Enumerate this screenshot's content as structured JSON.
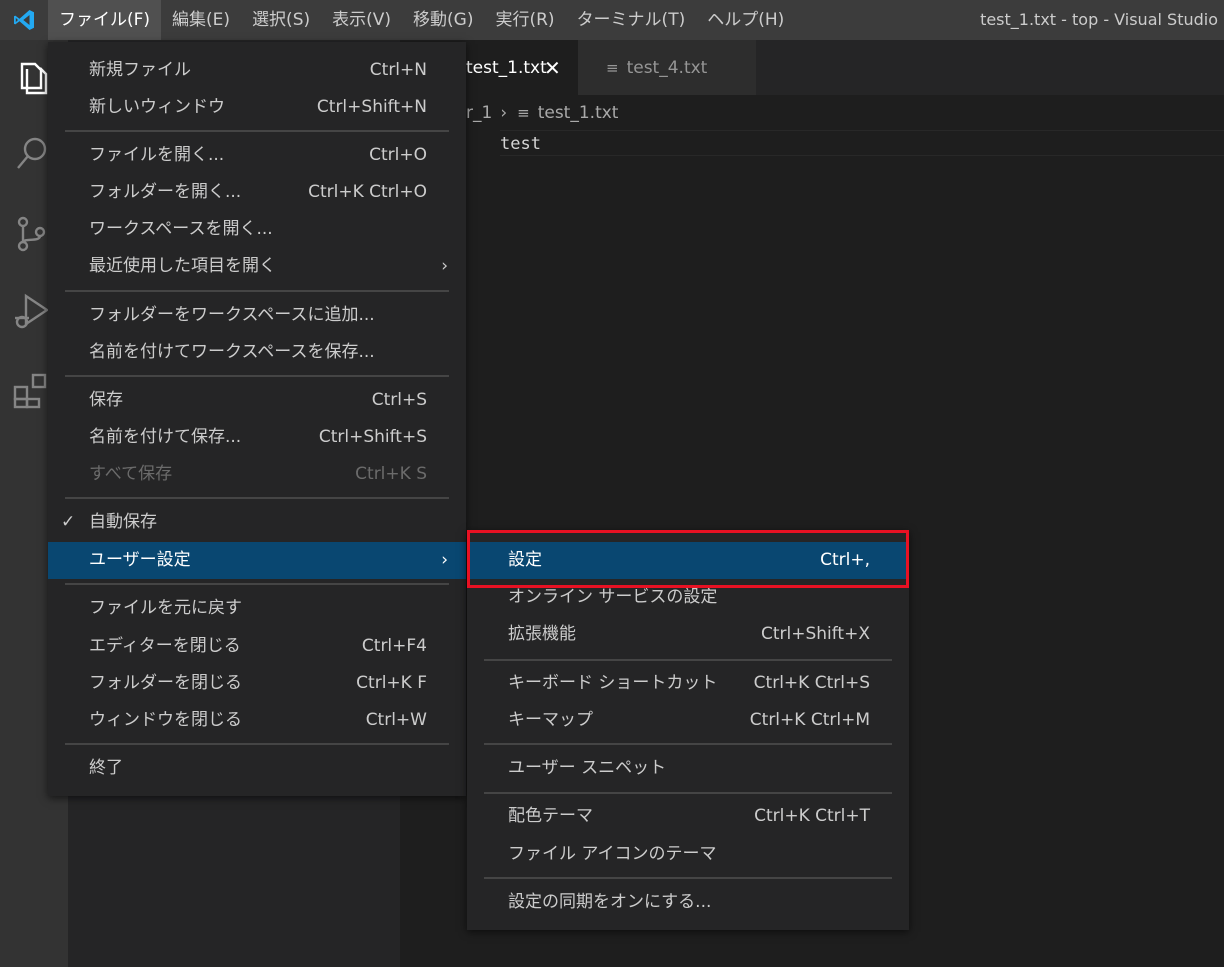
{
  "titlebar": {
    "menus": [
      "ファイル(F)",
      "編集(E)",
      "選択(S)",
      "表示(V)",
      "移動(G)",
      "実行(R)",
      "ターミナル(T)",
      "ヘルプ(H)"
    ],
    "window_title": "test_1.txt - top - Visual Studio"
  },
  "activitybar": {
    "icons": [
      "explorer-icon",
      "search-icon",
      "source-control-icon",
      "run-debug-icon",
      "extensions-icon"
    ]
  },
  "tabs": [
    {
      "label": "test_1.txt",
      "active": true
    },
    {
      "label": "test_4.txt",
      "active": false
    }
  ],
  "breadcrumb": {
    "folder": "r_1",
    "file": "test_1.txt"
  },
  "editor": {
    "line": "test"
  },
  "file_menu": {
    "items": [
      {
        "label": "新規ファイル",
        "shortcut": "Ctrl+N"
      },
      {
        "label": "新しいウィンドウ",
        "shortcut": "Ctrl+Shift+N"
      },
      {
        "label": "ファイルを開く...",
        "shortcut": "Ctrl+O"
      },
      {
        "label": "フォルダーを開く...",
        "shortcut": "Ctrl+K Ctrl+O"
      },
      {
        "label": "ワークスペースを開く...",
        "shortcut": ""
      },
      {
        "label": "最近使用した項目を開く",
        "shortcut": ""
      },
      {
        "label": "フォルダーをワークスペースに追加...",
        "shortcut": ""
      },
      {
        "label": "名前を付けてワークスペースを保存...",
        "shortcut": ""
      },
      {
        "label": "保存",
        "shortcut": "Ctrl+S"
      },
      {
        "label": "名前を付けて保存...",
        "shortcut": "Ctrl+Shift+S"
      },
      {
        "label": "すべて保存",
        "shortcut": "Ctrl+K S"
      },
      {
        "label": "自動保存",
        "shortcut": "",
        "checked": true
      },
      {
        "label": "ユーザー設定",
        "shortcut": ""
      },
      {
        "label": "ファイルを元に戻す",
        "shortcut": ""
      },
      {
        "label": "エディターを閉じる",
        "shortcut": "Ctrl+F4"
      },
      {
        "label": "フォルダーを閉じる",
        "shortcut": "Ctrl+K F"
      },
      {
        "label": "ウィンドウを閉じる",
        "shortcut": "Ctrl+W"
      },
      {
        "label": "終了",
        "shortcut": ""
      }
    ]
  },
  "submenu": {
    "items": [
      {
        "label": "設定",
        "shortcut": "Ctrl+,"
      },
      {
        "label": "オンライン サービスの設定",
        "shortcut": ""
      },
      {
        "label": "拡張機能",
        "shortcut": "Ctrl+Shift+X"
      },
      {
        "label": "キーボード ショートカット",
        "shortcut": "Ctrl+K Ctrl+S"
      },
      {
        "label": "キーマップ",
        "shortcut": "Ctrl+K Ctrl+M"
      },
      {
        "label": "ユーザー スニペット",
        "shortcut": ""
      },
      {
        "label": "配色テーマ",
        "shortcut": "Ctrl+K Ctrl+T"
      },
      {
        "label": "ファイル アイコンのテーマ",
        "shortcut": ""
      },
      {
        "label": "設定の同期をオンにする...",
        "shortcut": ""
      }
    ]
  },
  "colors": {
    "highlight": "#094771",
    "annotation_box": "#e81123",
    "vscode_blue": "#23a9f2"
  }
}
